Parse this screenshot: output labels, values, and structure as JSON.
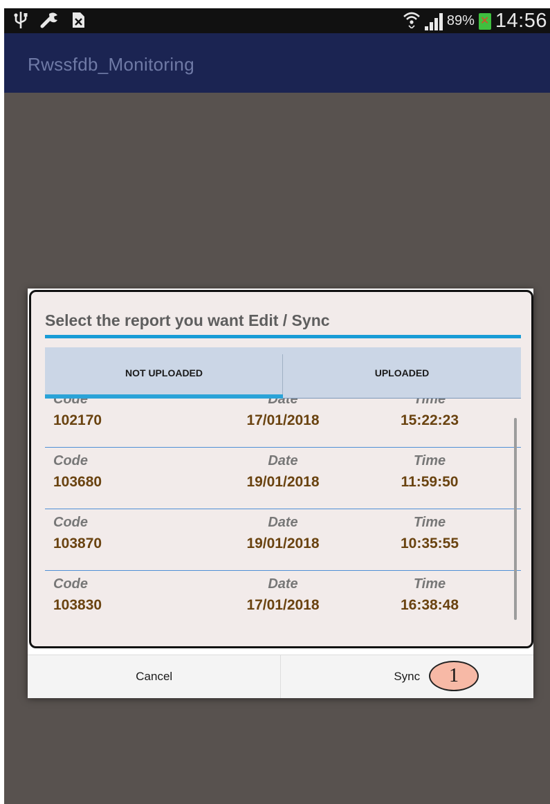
{
  "status_bar": {
    "icons_left": [
      "usb-icon",
      "wrench-icon",
      "sim-card-x-icon"
    ],
    "icons_right": [
      "wifi-icon",
      "signal-bars-icon",
      "battery-icon"
    ],
    "battery_percent": "89%",
    "time": "14:56"
  },
  "app_bar": {
    "title": "Rwssfdb_Monitoring"
  },
  "dialog": {
    "title": "Select the report you want Edit / Sync",
    "tabs": [
      {
        "label": "NOT UPLOADED",
        "selected": true
      },
      {
        "label": "UPLOADED",
        "selected": false
      }
    ],
    "column_labels": {
      "code": "Code",
      "date": "Date",
      "time": "Time"
    },
    "reports": [
      {
        "code": "102170",
        "date": "17/01/2018",
        "time": "15:22:23"
      },
      {
        "code": "103680",
        "date": "19/01/2018",
        "time": "11:59:50"
      },
      {
        "code": "103870",
        "date": "19/01/2018",
        "time": "10:35:55"
      },
      {
        "code": "103830",
        "date": "17/01/2018",
        "time": "16:38:48"
      }
    ],
    "buttons": {
      "cancel": "Cancel",
      "sync": "Sync"
    },
    "annotation_badge": "1"
  },
  "colors": {
    "app_bar": "#1b2452",
    "accent": "#199cd6",
    "value_text": "#6a4310",
    "dim_background": "#58524f",
    "badge_fill": "#f7b9a6"
  }
}
